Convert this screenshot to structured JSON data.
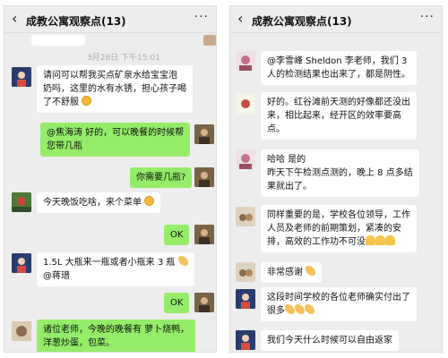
{
  "left": {
    "title": "成教公寓观察点(13)",
    "timestamp": "3月28日 下午15:01",
    "messages": [
      {
        "lines": [
          "请问可以帮我买点矿泉水给宝宝泡",
          "奶吗，这里的水有水锈，担心孩子喝",
          "了不舒服"
        ]
      },
      {
        "lines": [
          "@焦海涛  好的，可以晚餐的时候帮",
          "您带几瓶"
        ]
      },
      {
        "lines": [
          "你需要几瓶?"
        ]
      },
      {
        "lines": [
          "今天晚饭吃啥，来个菜单"
        ]
      },
      {
        "lines": [
          "OK"
        ]
      },
      {
        "lines": [
          "1.5L 大瓶来一瓶或者小瓶来 3 瓶",
          "@蒋瑨"
        ]
      },
      {
        "lines": [
          "OK"
        ]
      },
      {
        "lines": [
          "诸位老师，今晚的晚餐有 萝卜烧鸭，",
          "洋葱炒蛋，包菜。"
        ]
      }
    ]
  },
  "right": {
    "title": "成教公寓观察点(13)",
    "messages": [
      {
        "lines": [
          "@李雪峰 Sheldon  李老师，我们 3",
          "人的检测结果也出来了，都是阴性。"
        ]
      },
      {
        "lines": [
          "好的。红谷滩前天测的好像都还没出",
          "来，相比起来，经开区的效率要高",
          "点。"
        ]
      },
      {
        "lines": [
          "哈哈 是的",
          "昨天下午检测点测的，晚上 8 点多结",
          "果就出了。"
        ]
      },
      {
        "lines": [
          "同样重要的是，学校各位领导，工作",
          "人员及老师的前期策划，紧凑的安",
          "排，高效的工作功不可没"
        ]
      },
      {
        "lines": [
          "非常感谢"
        ]
      },
      {
        "lines": [
          "这段时间学校的各位老师确实付出了",
          "很多"
        ]
      },
      {
        "lines": [
          "我们今天什么时候可以自由返家"
        ]
      }
    ]
  },
  "icons": {
    "back": "‹",
    "more": "···"
  },
  "colors": {
    "green_bubble": "#95ec69",
    "white_bubble": "#ffffff",
    "background": "#ededed"
  }
}
